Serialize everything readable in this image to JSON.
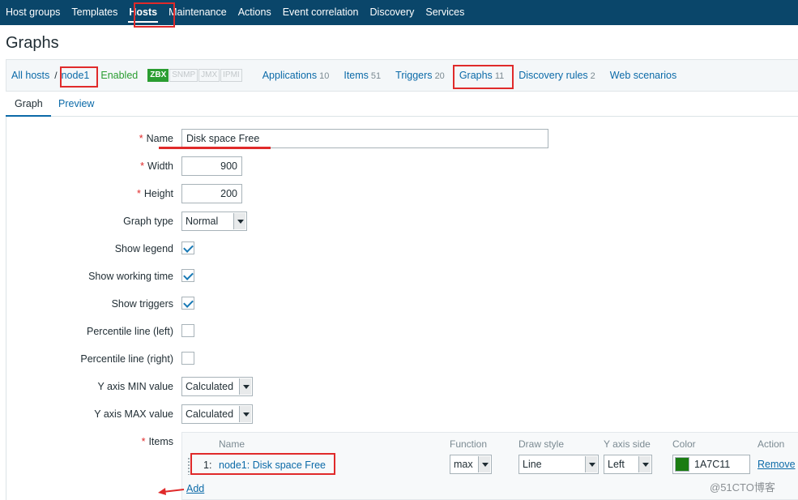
{
  "topnav": {
    "items": [
      "Host groups",
      "Templates",
      "Hosts",
      "Maintenance",
      "Actions",
      "Event correlation",
      "Discovery",
      "Services"
    ],
    "active": "Hosts"
  },
  "page": {
    "title": "Graphs"
  },
  "hostbar": {
    "all_hosts": "All hosts",
    "separator": "/",
    "host": "node1",
    "status": "Enabled",
    "badges": [
      "ZBX",
      "SNMP",
      "JMX",
      "IPMI"
    ],
    "links": [
      {
        "label": "Applications",
        "count": "10"
      },
      {
        "label": "Items",
        "count": "51"
      },
      {
        "label": "Triggers",
        "count": "20"
      },
      {
        "label": "Graphs",
        "count": "11"
      },
      {
        "label": "Discovery rules",
        "count": "2"
      },
      {
        "label": "Web scenarios",
        "count": ""
      }
    ]
  },
  "tabs": [
    "Graph",
    "Preview"
  ],
  "form": {
    "name": {
      "label": "Name",
      "value": "Disk space Free"
    },
    "width": {
      "label": "Width",
      "value": "900"
    },
    "height": {
      "label": "Height",
      "value": "200"
    },
    "graph_type": {
      "label": "Graph type",
      "value": "Normal"
    },
    "show_legend": {
      "label": "Show legend",
      "checked": true
    },
    "show_working_time": {
      "label": "Show working time",
      "checked": true
    },
    "show_triggers": {
      "label": "Show triggers",
      "checked": true
    },
    "percentile_left": {
      "label": "Percentile line (left)",
      "checked": false
    },
    "percentile_right": {
      "label": "Percentile line (right)",
      "checked": false
    },
    "y_min": {
      "label": "Y axis MIN value",
      "value": "Calculated"
    },
    "y_max": {
      "label": "Y axis MAX value",
      "value": "Calculated"
    },
    "items_label": "Items"
  },
  "items_table": {
    "headers": [
      "Name",
      "Function",
      "Draw style",
      "Y axis side",
      "Color",
      "Action"
    ],
    "rows": [
      {
        "index": "1:",
        "name": "node1: Disk space Free",
        "function": "max",
        "draw_style": "Line",
        "y_axis_side": "Left",
        "color": "1A7C11",
        "color_hex": "#1A7C11",
        "action": "Remove"
      }
    ],
    "add": "Add"
  },
  "watermark": "@51CTO博客",
  "colors": {
    "nav_bg": "#0a466a",
    "link": "#0b6aa8",
    "enabled": "#2a9d31",
    "highlight": "#e02a2a"
  }
}
